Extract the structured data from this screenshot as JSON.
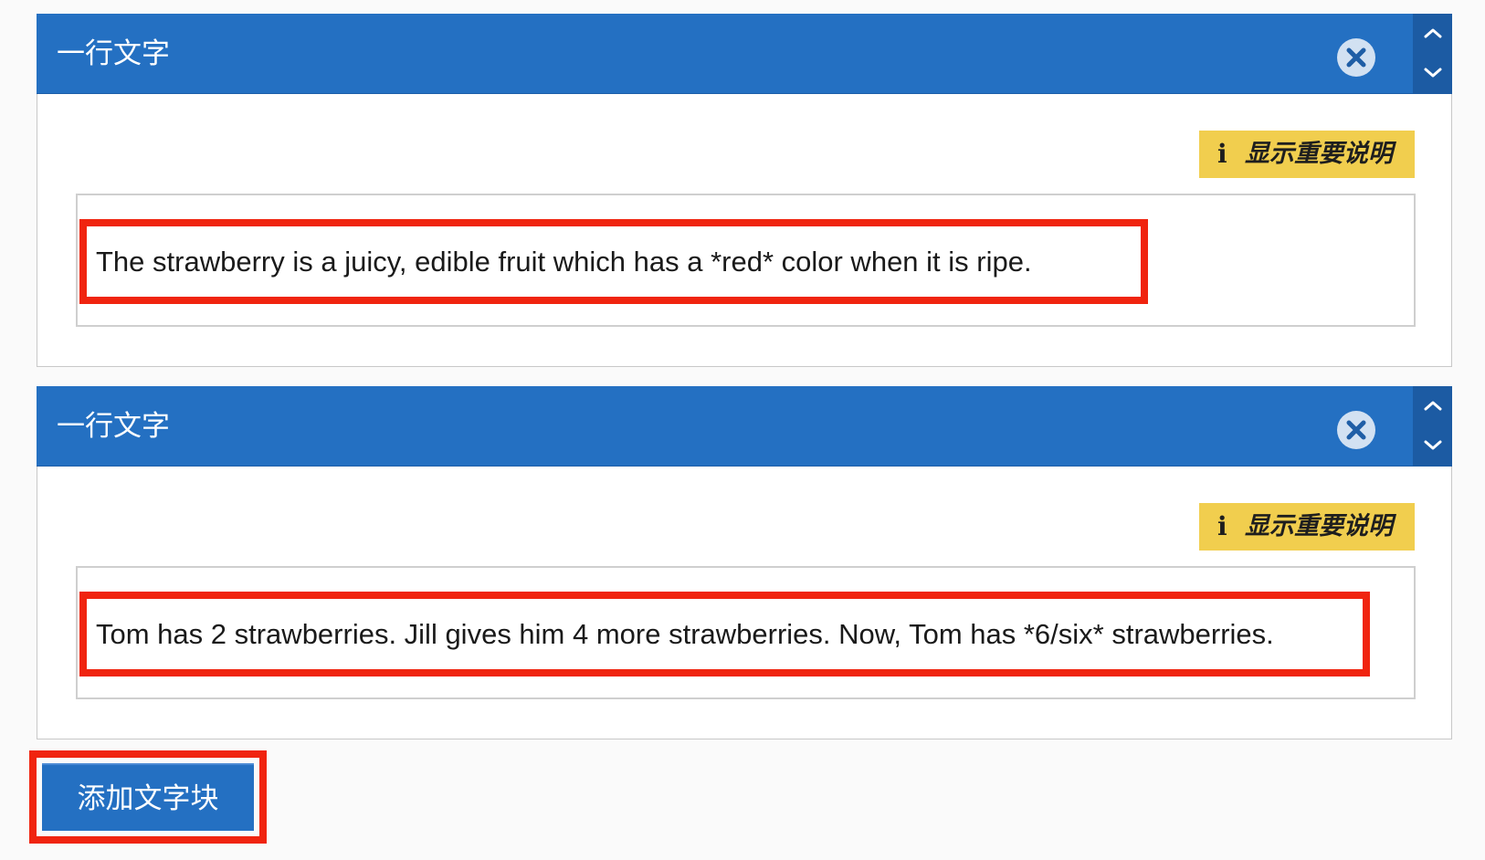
{
  "blocks": [
    {
      "title": "一行文字",
      "info_label": "显示重要说明",
      "info_icon": "i",
      "text": "The strawberry is a juicy, edible fruit which has a *red* color when it is ripe."
    },
    {
      "title": "一行文字",
      "info_label": "显示重要说明",
      "info_icon": "i",
      "text": "Tom has 2 strawberries. Jill gives him 4 more strawberries. Now, Tom has *6/six* strawberries."
    }
  ],
  "add_button": {
    "label": "添加文字块"
  },
  "colors": {
    "header_blue": "#2470c2",
    "sort_blue": "#1c5ba3",
    "badge_yellow": "#f1ce4e",
    "highlight_red": "#f0240f"
  },
  "icons": {
    "close": "close-icon",
    "up": "chevron-up-icon",
    "down": "chevron-down-icon",
    "info": "info-icon"
  }
}
